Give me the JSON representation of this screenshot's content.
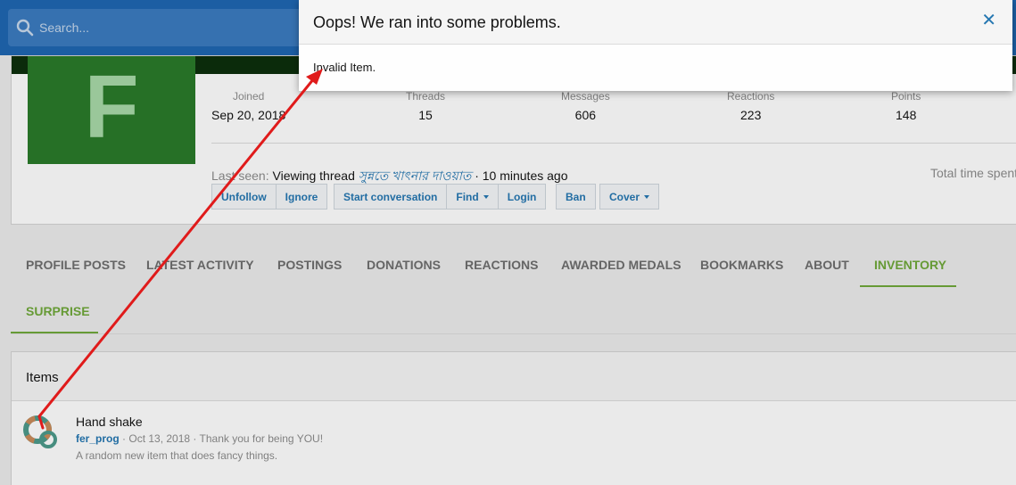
{
  "search": {
    "placeholder": "Search..."
  },
  "profile": {
    "avatar_letter": "F",
    "stats": [
      {
        "label": "Joined",
        "value": "Sep 20, 2018"
      },
      {
        "label": "Threads",
        "value": "15"
      },
      {
        "label": "Messages",
        "value": "606"
      },
      {
        "label": "Reactions",
        "value": "223"
      },
      {
        "label": "Points",
        "value": "148"
      }
    ],
    "last_seen_prefix": "Last seen:",
    "last_seen_activity": "Viewing thread",
    "last_seen_thread": "সুন্নতে খাৎনার দাওয়াত",
    "last_seen_time": "· 10 minutes ago",
    "total_time_label": "Total time spent",
    "buttons": {
      "unfollow": "Unfollow",
      "ignore": "Ignore",
      "start_conversation": "Start conversation",
      "find": "Find",
      "login": "Login",
      "ban": "Ban",
      "cover": "Cover"
    }
  },
  "tabs": [
    {
      "label": "PROFILE POSTS"
    },
    {
      "label": "LATEST ACTIVITY"
    },
    {
      "label": "POSTINGS"
    },
    {
      "label": "DONATIONS"
    },
    {
      "label": "REACTIONS"
    },
    {
      "label": "AWARDED MEDALS"
    },
    {
      "label": "BOOKMARKS"
    },
    {
      "label": "ABOUT"
    },
    {
      "label": "INVENTORY"
    },
    {
      "label": "SURPRISE"
    }
  ],
  "items_section": {
    "heading": "Items",
    "item": {
      "title": "Hand shake",
      "user": "fer_prog",
      "date": "· Oct 13, 2018 ·",
      "note": "Thank you for being YOU!",
      "description": "A random new item that does fancy things."
    }
  },
  "modal": {
    "title": "Oops! We ran into some problems.",
    "close_glyph": "✕",
    "message": "Invalid Item."
  },
  "colors": {
    "header_blue": "#1f66b1",
    "link_blue": "#2577b1",
    "active_tab_green": "#6fa83a",
    "avatar_green": "#2a7a2a",
    "annotation_arrow": "#e01b1b"
  }
}
